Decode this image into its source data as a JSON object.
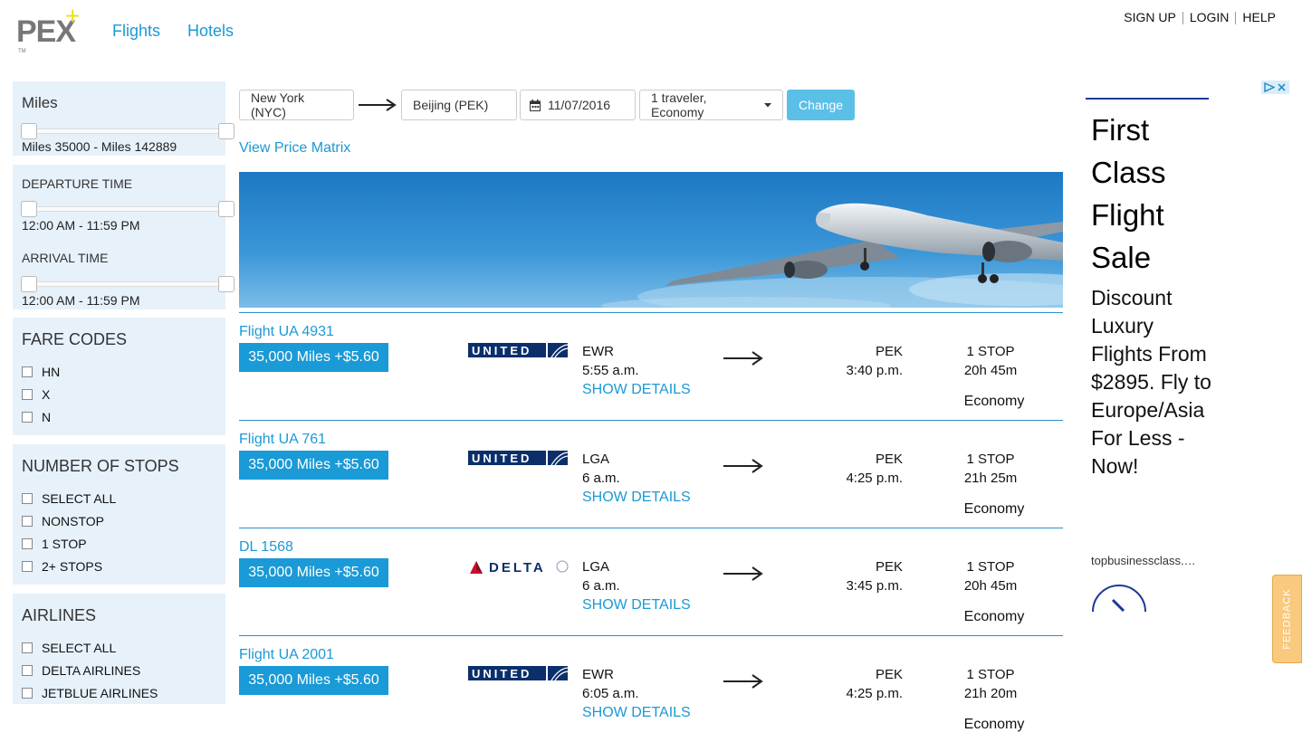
{
  "header": {
    "logo_text": "PEX",
    "logo_tm": "TM",
    "nav": [
      "Flights",
      "Hotels"
    ],
    "top_links": [
      "SIGN UP",
      "LOGIN",
      "HELP"
    ]
  },
  "sidebar": {
    "miles": {
      "title": "Miles",
      "range_text": "Miles 35000 - Miles 142889"
    },
    "times": {
      "departure_title": "DEPARTURE TIME",
      "departure_range": "12:00 AM - 11:59 PM",
      "arrival_title": "ARRIVAL TIME",
      "arrival_range": "12:00 AM - 11:59 PM"
    },
    "fare_codes": {
      "title": "FARE CODES",
      "options": [
        "HN",
        "X",
        "N"
      ]
    },
    "stops": {
      "title": "NUMBER OF STOPS",
      "options": [
        "SELECT ALL",
        "NONSTOP",
        "1 STOP",
        "2+ STOPS"
      ]
    },
    "airlines": {
      "title": "AIRLINES",
      "options": [
        "SELECT ALL",
        "DELTA AIRLINES",
        "JETBLUE AIRLINES"
      ]
    }
  },
  "search": {
    "origin": "New York (NYC)",
    "destination": "Beijing (PEK)",
    "date": "11/07/2016",
    "travelers": "1 traveler, Economy",
    "change_label": "Change"
  },
  "view_price_matrix": "View Price Matrix",
  "results": [
    {
      "flight": "Flight UA 4931",
      "price": "35,000 Miles +$5.60",
      "airline": "UNITED",
      "dep_code": "EWR",
      "dep_time": "5:55 a.m.",
      "details": "SHOW DETAILS",
      "arr_code": "PEK",
      "arr_time": "3:40 p.m.",
      "stops": "1 STOP",
      "duration": "20h 45m",
      "cabin": "Economy"
    },
    {
      "flight": "Flight UA 761",
      "price": "35,000 Miles +$5.60",
      "airline": "UNITED",
      "dep_code": "LGA",
      "dep_time": "6 a.m.",
      "details": "SHOW DETAILS",
      "arr_code": "PEK",
      "arr_time": "4:25 p.m.",
      "stops": "1 STOP",
      "duration": "21h 25m",
      "cabin": "Economy"
    },
    {
      "flight": "DL 1568",
      "price": "35,000 Miles +$5.60",
      "airline": "DELTA",
      "dep_code": "LGA",
      "dep_time": "6 a.m.",
      "details": "SHOW DETAILS",
      "arr_code": "PEK",
      "arr_time": "3:45 p.m.",
      "stops": "1 STOP",
      "duration": "20h 45m",
      "cabin": "Economy"
    },
    {
      "flight": "Flight UA 2001",
      "price": "35,000 Miles +$5.60",
      "airline": "UNITED",
      "dep_code": "EWR",
      "dep_time": "6:05 a.m.",
      "details": "SHOW DETAILS",
      "arr_code": "PEK",
      "arr_time": "4:25 p.m.",
      "stops": "1 STOP",
      "duration": "21h 20m",
      "cabin": "Economy"
    }
  ],
  "ad": {
    "headline": "First Class Flight Sale",
    "body": "Discount Luxury Flights From $2895. Fly to Europe/Asia For Less - Now!",
    "domain": "topbusinessclass.…"
  },
  "feedback_label": "FEEDBACK",
  "colors": {
    "accent": "#1a9ad6",
    "sidebar_bg": "#e6f1fa",
    "change_button": "#5bc0e8",
    "feedback": "#f9c97e"
  }
}
